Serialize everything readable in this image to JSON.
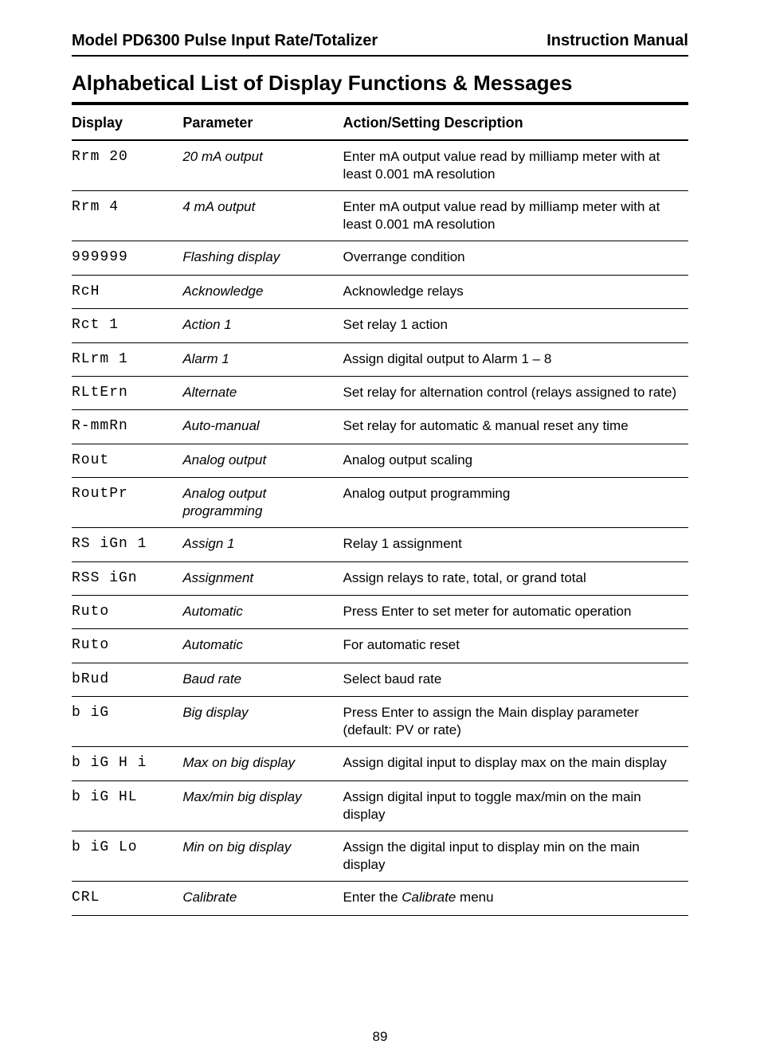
{
  "header": {
    "left": "Model PD6300 Pulse Input Rate/Totalizer",
    "right": "Instruction Manual"
  },
  "title": "Alphabetical List of Display Functions & Messages",
  "columns": {
    "c1": "Display",
    "c2": "Parameter",
    "c3": "Action/Setting Description"
  },
  "rows": [
    {
      "display": "Rrm 20",
      "param": "20 mA output",
      "action": "Enter mA output value read by milliamp meter with at least 0.001 mA resolution"
    },
    {
      "display": "Rrm 4",
      "param": "4 mA output",
      "action": "Enter mA output value read by milliamp meter with at least 0.001 mA resolution"
    },
    {
      "display": "999999",
      "param": "Flashing display",
      "action": "Overrange condition"
    },
    {
      "display": "RcH",
      "param": "Acknowledge",
      "action": "Acknowledge relays"
    },
    {
      "display": "Rct  1",
      "param": "Action 1",
      "action": "Set relay 1 action"
    },
    {
      "display": "RLrm  1",
      "param": "Alarm 1",
      "action": "Assign digital output to Alarm 1 – 8"
    },
    {
      "display": "RLtErn",
      "param": "Alternate",
      "action": "Set relay for alternation control (relays assigned to rate)"
    },
    {
      "display": "R-mmRn",
      "param": "Auto-manual",
      "action": "Set relay for automatic & manual reset any time"
    },
    {
      "display": "Rout",
      "param": "Analog output",
      "action": "Analog output scaling"
    },
    {
      "display": "RoutPr",
      "param": "Analog output programming",
      "action": "Analog output programming"
    },
    {
      "display": "RS iGn 1",
      "param": "Assign 1",
      "action": "Relay 1 assignment"
    },
    {
      "display": "RSS iGn",
      "param": "Assignment",
      "action": "Assign relays to rate, total, or grand total"
    },
    {
      "display": "Ruto",
      "param": "Automatic",
      "action": "Press Enter to set meter for automatic operation"
    },
    {
      "display": "Ruto",
      "param": "Automatic",
      "action": "For automatic reset"
    },
    {
      "display": "bRud",
      "param": "Baud rate",
      "action": "Select baud rate"
    },
    {
      "display": "b iG",
      "param": "Big display",
      "action": "Press Enter to assign the Main display parameter (default: PV or rate)"
    },
    {
      "display": "b iG H i",
      "param": "Max on big display",
      "action": "Assign digital input to display max on the main display"
    },
    {
      "display": "b iG HL",
      "param": "Max/min big display",
      "action": "Assign digital input to toggle max/min on the main display"
    },
    {
      "display": "b iG Lo",
      "param": "Min on big display",
      "action": "Assign the digital input to display min on the main display"
    },
    {
      "display": "CRL",
      "param": "Calibrate",
      "action_prefix": "Enter the ",
      "action_ital": "Calibrate",
      "action_suffix": " menu"
    }
  ],
  "page_number": "89"
}
